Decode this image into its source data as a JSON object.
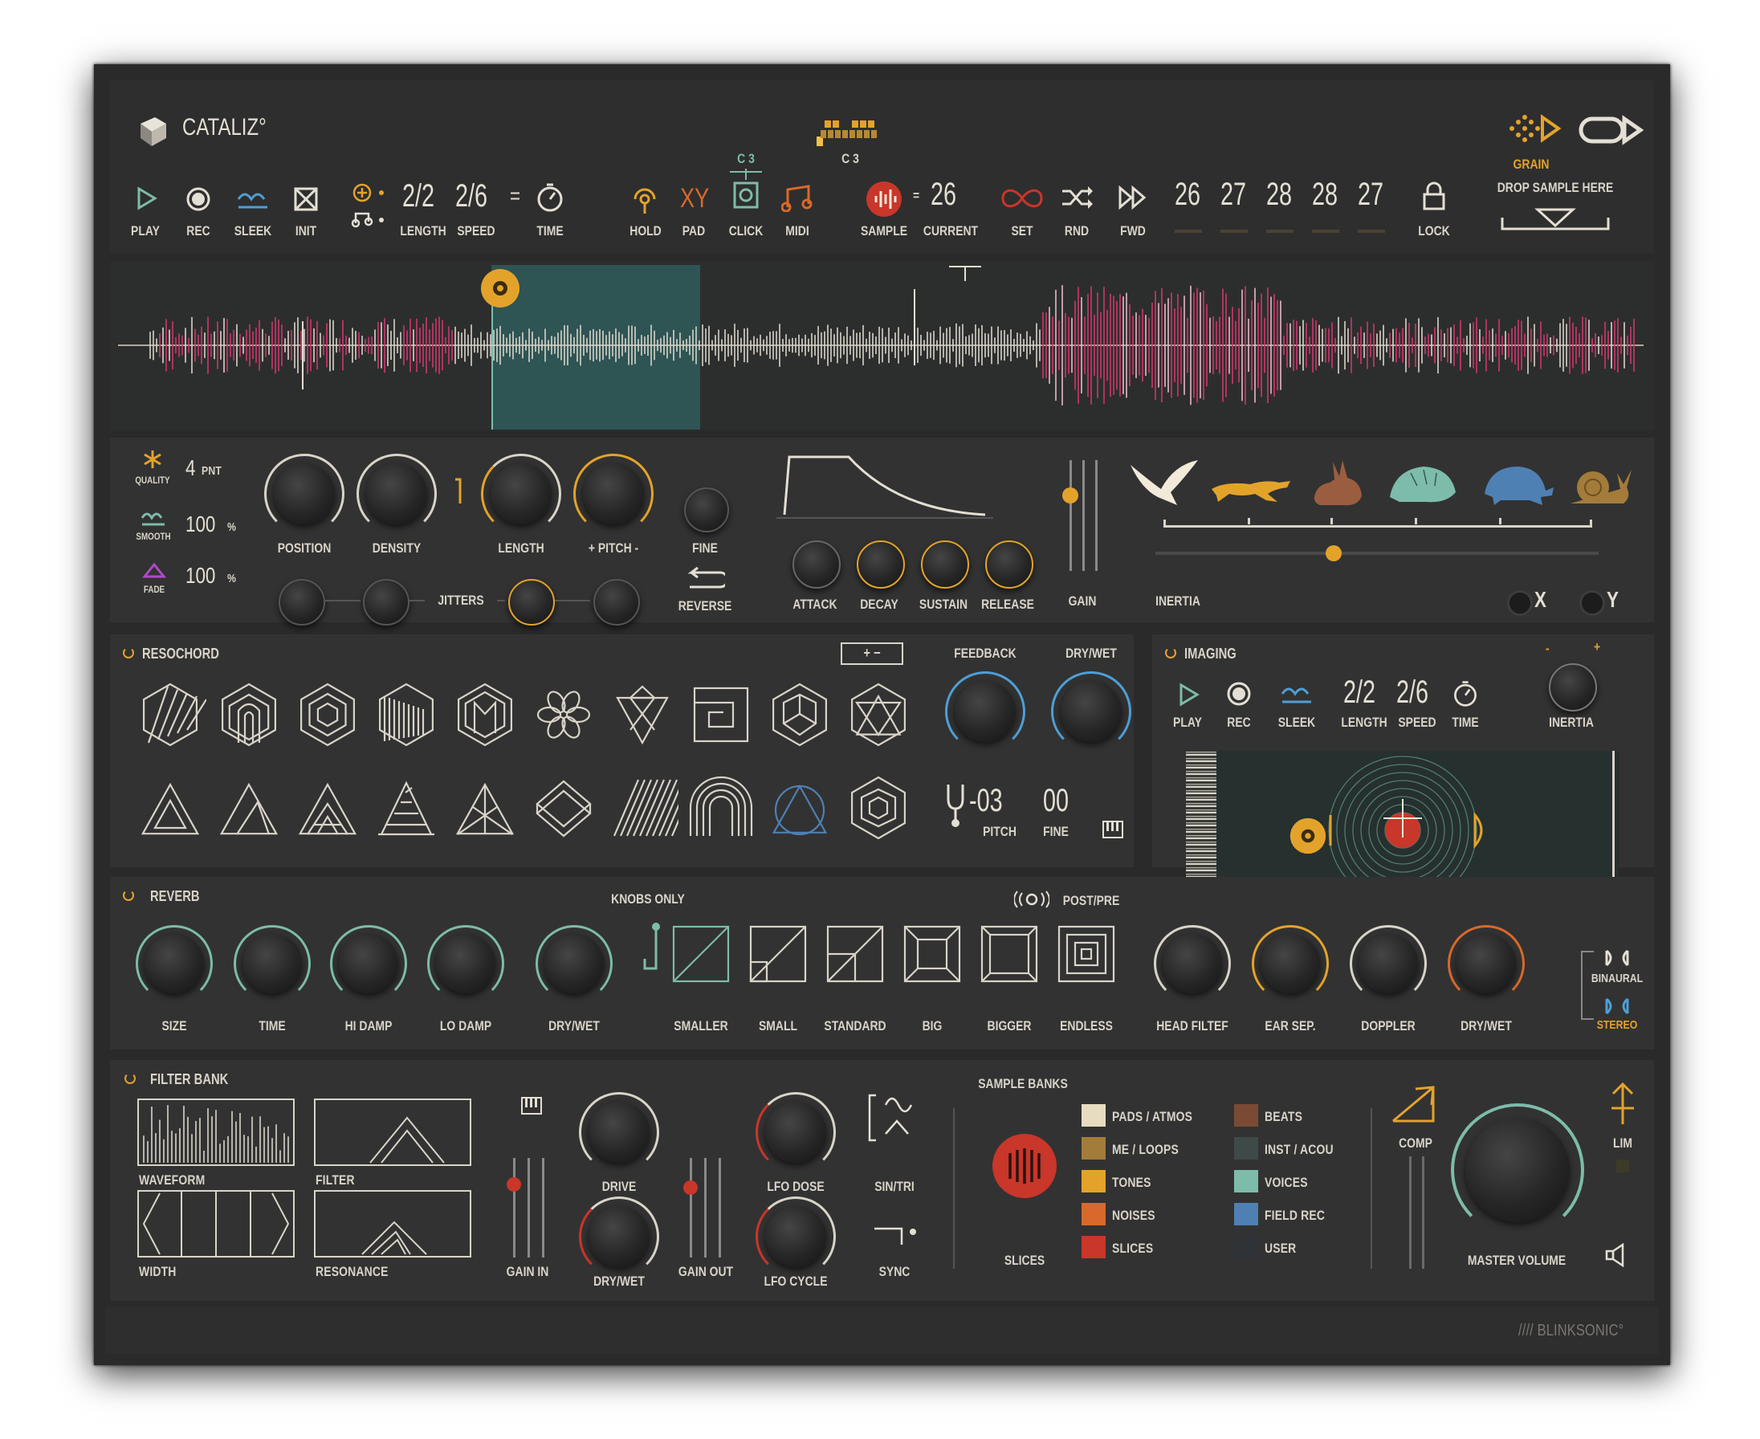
{
  "brand": {
    "name": "CATALIZ°",
    "footer": "//// BLINKSONIC°"
  },
  "header": {
    "note": "C 3",
    "grain_label": "GRAIN",
    "drop_label": "DROP SAMPLE HERE",
    "transport": [
      {
        "label": "PLAY",
        "icon": "play-icon"
      },
      {
        "label": "REC",
        "icon": "record-icon"
      },
      {
        "label": "SLEEK",
        "icon": "sleek-icon"
      },
      {
        "label": "INIT",
        "icon": "init-icon"
      }
    ],
    "length_value": "2/2",
    "length_label": "LENGTH",
    "speed_value": "2/6",
    "speed_label": "SPEED",
    "equals": "=",
    "time_label": "TIME",
    "hold_label": "HOLD",
    "pad_value": "XY",
    "pad_label": "PAD",
    "click_label": "CLICK",
    "click_sub": "C 3",
    "midi_label": "MIDI",
    "sample_label": "SAMPLE",
    "current_value": "26",
    "current_label": "CURRENT",
    "set_label": "SET",
    "rnd_label": "RND",
    "fwd_label": "FWD",
    "slots": [
      "26",
      "27",
      "28",
      "28",
      "27"
    ],
    "lock_label": "LOCK"
  },
  "grain": {
    "quality_value": "4",
    "quality_unit": "PNT",
    "quality_label": "QUALITY",
    "smooth_value": "100",
    "smooth_unit": "%",
    "smooth_label": "SMOOTH",
    "fade_value": "100",
    "fade_unit": "%",
    "fade_label": "FADE",
    "knobs": [
      "POSITION",
      "DENSITY",
      "LENGTH",
      "+ PITCH -",
      "FINE"
    ],
    "jitters_label": "JITTERS",
    "reverse_label": "REVERSE",
    "env": [
      "ATTACK",
      "DECAY",
      "SUSTAIN",
      "RELEASE"
    ],
    "gain_label": "GAIN",
    "inertia_label": "INERTIA",
    "x_label": "X",
    "y_label": "Y"
  },
  "resochord": {
    "title": "RESOCHORD",
    "plusminus": "+ −",
    "feedback_label": "FEEDBACK",
    "drywet_label": "DRY/WET",
    "pitch_value": "-03",
    "pitch_label": "PITCH",
    "fine_value": "00",
    "fine_label": "FINE"
  },
  "imaging": {
    "title": "IMAGING",
    "play": "PLAY",
    "rec": "REC",
    "sleek": "SLEEK",
    "length_value": "2/2",
    "length_label": "LENGTH",
    "speed_value": "2/6",
    "speed_label": "SPEED",
    "time_label": "TIME",
    "inertia_label": "INERTIA",
    "minus": "-",
    "plus": "+"
  },
  "reverb": {
    "title": "REVERB",
    "knobs_only": "KNOBS ONLY",
    "postpre": "POST/PRE",
    "knobs": [
      "SIZE",
      "TIME",
      "HI DAMP",
      "LO DAMP",
      "DRY/WET"
    ],
    "rooms": [
      "SMALLER",
      "SMALL",
      "STANDARD",
      "BIG",
      "BIGGER",
      "ENDLESS"
    ],
    "spatial": [
      "HEAD FILTEF",
      "EAR SEP.",
      "DOPPLER",
      "DRY/WET"
    ],
    "binaural": "BINAURAL",
    "stereo": "STEREO"
  },
  "filterbank": {
    "title": "FILTER BANK",
    "boxes": [
      "WAVEFORM",
      "FILTER",
      "WIDTH",
      "RESONANCE"
    ],
    "gain_in": "GAIN IN",
    "drive": "DRIVE",
    "drywet": "DRY/WET",
    "gain_out": "GAIN OUT",
    "lfo_dose": "LFO DOSE",
    "lfo_cycle": "LFO CYCLE",
    "sintri": "SIN/TRI",
    "sync": "SYNC"
  },
  "banks": {
    "title": "SAMPLE BANKS",
    "slices_label": "SLICES",
    "items": [
      {
        "label": "PADS / ATMOS",
        "color": "#e8dcc0"
      },
      {
        "label": "ME / LOOPS",
        "color": "#a37c3a"
      },
      {
        "label": "TONES",
        "color": "#e3a32b"
      },
      {
        "label": "NOISES",
        "color": "#d9692a"
      },
      {
        "label": "SLICES",
        "color": "#c9362a"
      },
      {
        "label": "BEATS",
        "color": "#7a4a34"
      },
      {
        "label": "INST / ACOU",
        "color": "#3e4a48"
      },
      {
        "label": "VOICES",
        "color": "#7dbcaa"
      },
      {
        "label": "FIELD REC",
        "color": "#4e80b3"
      },
      {
        "label": "USER",
        "color": "#2f3338"
      }
    ]
  },
  "master": {
    "comp": "COMP",
    "lim": "LIM",
    "volume": "MASTER VOLUME"
  },
  "colors": {
    "accent": "#e3a32b",
    "teal": "#7dbcaa",
    "red": "#c9362a",
    "pink": "#d0366d",
    "blue": "#4e80b3"
  }
}
